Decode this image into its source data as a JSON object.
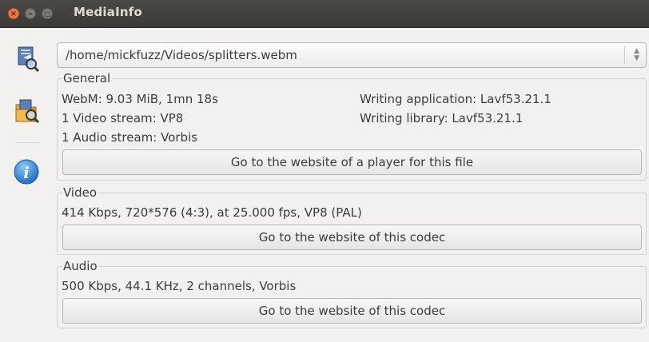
{
  "window": {
    "title": "MediaInfo"
  },
  "sidebar": [
    {
      "icon": "open-file-icon"
    },
    {
      "icon": "open-folder-icon"
    },
    {
      "icon": "info-icon"
    }
  ],
  "file_select": {
    "value": "/home/mickfuzz/Videos/splitters.webm"
  },
  "general": {
    "title": "General",
    "left": [
      "WebM: 9.03 MiB, 1mn 18s",
      "1 Video stream: VP8",
      "1 Audio stream: Vorbis"
    ],
    "right": [
      "Writing application: Lavf53.21.1",
      "Writing library: Lavf53.21.1"
    ],
    "button": "Go to the website of a player for this file"
  },
  "video": {
    "title": "Video",
    "info": "414 Kbps, 720*576 (4:3), at 25.000 fps, VP8 (PAL)",
    "button": "Go to the website of this codec"
  },
  "audio": {
    "title": "Audio",
    "info": "500 Kbps, 44.1 KHz, 2 channels, Vorbis",
    "button": "Go to the website of this codec"
  },
  "colors": {
    "titlebar": "#3c3b37",
    "close": "#f07746",
    "window_bg": "#f2f1f0",
    "info_blue": "#2f8ad8"
  }
}
